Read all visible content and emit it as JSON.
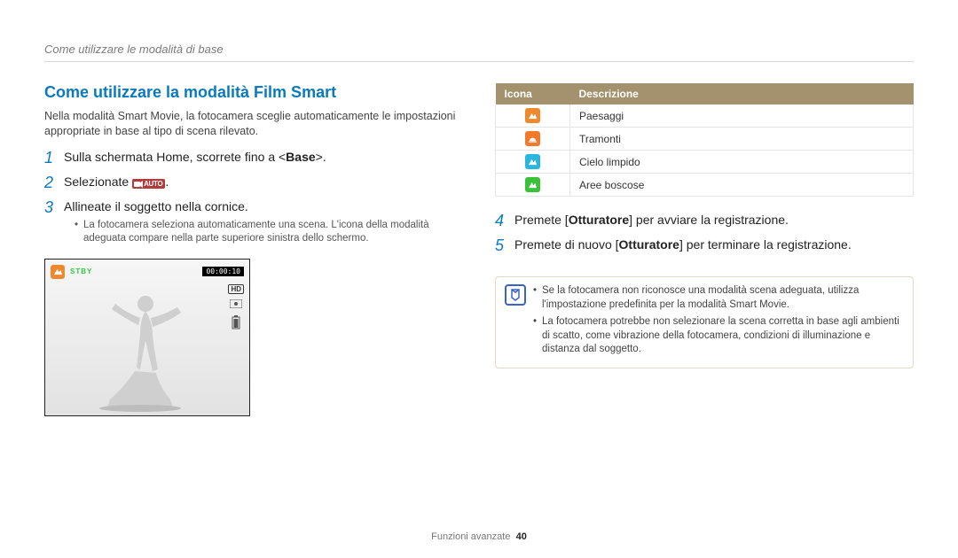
{
  "breadcrumb": "Come utilizzare le modalità di base",
  "heading": "Come utilizzare la modalità Film Smart",
  "intro": "Nella modalità Smart Movie, la fotocamera sceglie automaticamente le impostazioni appropriate in base al tipo di scena rilevato.",
  "steps_left": [
    {
      "num": "1",
      "html_parts": [
        "Sulla schermata Home, scorrete fino a <",
        "Base",
        ">."
      ],
      "sub": null
    },
    {
      "num": "2",
      "text_before_icon": "Selezionate ",
      "text_after_icon": ".",
      "sub": null,
      "has_icon": true
    },
    {
      "num": "3",
      "text": "Allineate il soggetto nella cornice.",
      "sub": "La fotocamera seleziona automaticamente una scena. L'icona della modalità adeguata compare nella parte superiore sinistra dello schermo."
    }
  ],
  "camera_preview": {
    "stby": "STBY",
    "timecode": "00:00:10",
    "hd_label": "HD"
  },
  "icon_table": {
    "header_icon": "Icona",
    "header_desc": "Descrizione",
    "rows": [
      {
        "color": "c-orange",
        "label": "Paesaggi"
      },
      {
        "color": "c-orange2",
        "label": "Tramonti"
      },
      {
        "color": "c-cyan",
        "label": "Cielo limpido"
      },
      {
        "color": "c-green",
        "label": "Aree boscose"
      }
    ]
  },
  "steps_right": [
    {
      "num": "4",
      "parts": [
        "Premete [",
        "Otturatore",
        "] per avviare la registrazione."
      ]
    },
    {
      "num": "5",
      "parts": [
        "Premete di nuovo [",
        "Otturatore",
        "] per terminare la registrazione."
      ]
    }
  ],
  "note_items": [
    "Se la fotocamera non riconosce una modalità scena adeguata, utilizza l'impostazione predefinita per la modalità Smart Movie.",
    "La fotocamera potrebbe non selezionare la scena corretta in base agli ambienti di scatto, come vibrazione della fotocamera, condizioni di illuminazione e distanza dal soggetto."
  ],
  "footer_label": "Funzioni avanzate",
  "footer_page": "40"
}
